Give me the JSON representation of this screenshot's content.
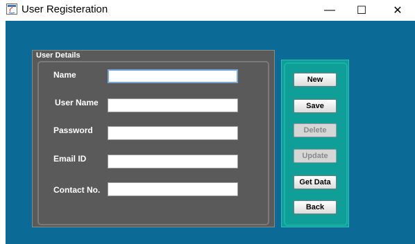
{
  "window": {
    "title": "User Registeration",
    "minimize_glyph": "—",
    "maximize_glyph": "☐",
    "close_glyph": "✕"
  },
  "user_panel": {
    "title": "User Details",
    "fields": [
      {
        "label": "Name",
        "value": ""
      },
      {
        "label": "User Name",
        "value": ""
      },
      {
        "label": "Password",
        "value": ""
      },
      {
        "label": "Email ID",
        "value": ""
      },
      {
        "label": "Contact No.",
        "value": ""
      }
    ]
  },
  "buttons": {
    "new": "New",
    "save": "Save",
    "delete": "Delete",
    "update": "Update",
    "get_data": "Get Data",
    "back": "Back"
  },
  "colors": {
    "background": "#0b6a96",
    "user_panel": "#5a5a5a",
    "button_panel": "#0f9e98"
  }
}
